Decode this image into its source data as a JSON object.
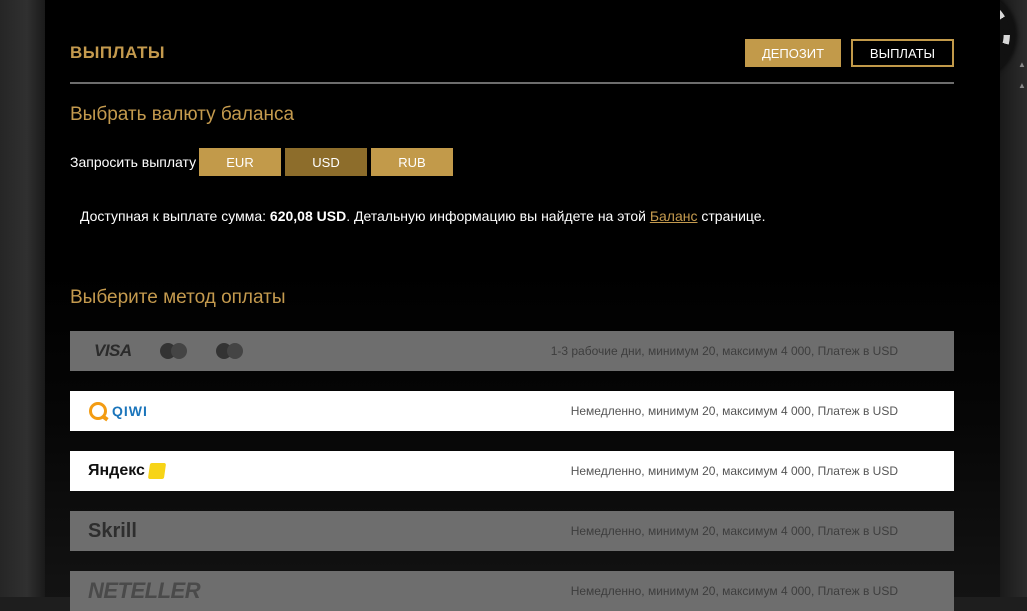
{
  "header": {
    "title": "ВЫПЛАТЫ",
    "deposit_label": "ДЕПОЗИТ",
    "payouts_label": "ВЫПЛАТЫ"
  },
  "currency_section": {
    "title": "Выбрать валюту баланса",
    "request_label": "Запросить выплату",
    "currencies": [
      "EUR",
      "USD",
      "RUB"
    ],
    "selected": "USD"
  },
  "available": {
    "prefix": "Доступная к выплате сумма: ",
    "amount": "620,08 USD",
    "middle": ". Детальную информацию вы найдете на этой ",
    "link": "Баланс",
    "suffix": " странице."
  },
  "payment_section": {
    "title": "Выберите метод оплаты",
    "methods": [
      {
        "name": "VISA",
        "info": "1-3 рабочие дни, минимум 20, максимум 4 000, Платеж в USD",
        "style": "gray"
      },
      {
        "name": "QIWI",
        "info": "Немедленно, минимум 20, максимум 4 000, Платеж в USD",
        "style": "white"
      },
      {
        "name": "Яндекс",
        "info": "Немедленно, минимум 20, максимум 4 000, Платеж в USD",
        "style": "white"
      },
      {
        "name": "Skrill",
        "info": "Немедленно, минимум 20, максимум 4 000, Платеж в USD",
        "style": "gray"
      },
      {
        "name": "NETELLER",
        "info": "Немедленно, минимум 20, максимум 4 000, Платеж в USD",
        "style": "gray"
      }
    ]
  },
  "colors": {
    "accent": "#c29a4a",
    "accent_dark": "#8d6d2b",
    "panel_bg": "#000000",
    "row_gray": "#6e6e6e"
  }
}
